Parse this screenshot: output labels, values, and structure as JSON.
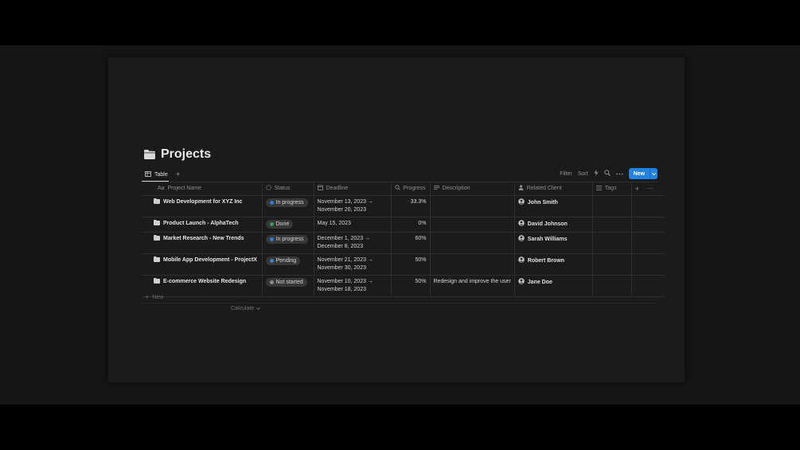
{
  "page": {
    "title": "Projects",
    "folder_icon": "folder-icon"
  },
  "views": {
    "active_tab": "Table",
    "add_view": "+"
  },
  "toolbar": {
    "filter": "Filter",
    "sort": "Sort",
    "new_label": "New"
  },
  "columns": {
    "name": "Project Name",
    "status": "Status",
    "deadline": "Deadline",
    "progress": "Progress",
    "description": "Description",
    "client": "Related Client",
    "tags": "Tags"
  },
  "rows": [
    {
      "name": "Web Development for XYZ Inc",
      "status": "In progress",
      "deadline_start": "November 13, 2023 →",
      "deadline_end": "November 20, 2023",
      "progress": "33.3%",
      "description": "",
      "client": "John Smith"
    },
    {
      "name": "Product Launch - AlphaTech",
      "status": "Done",
      "deadline_start": "May 15, 2023",
      "deadline_end": "",
      "progress": "0%",
      "description": "",
      "client": "David Johnson"
    },
    {
      "name": "Market Research - New Trends",
      "status": "In progress",
      "deadline_start": "December 1, 2023 →",
      "deadline_end": "December 8, 2023",
      "progress": "60%",
      "description": "",
      "client": "Sarah Williams"
    },
    {
      "name": "Mobile App Development - ProjectX",
      "status": "Pending",
      "deadline_start": "November 21, 2023 →",
      "deadline_end": "November 30, 2023",
      "progress": "50%",
      "description": "",
      "client": "Robert Brown"
    },
    {
      "name": "E-commerce Website Redesign",
      "status": "Not started",
      "deadline_start": "November 10, 2023 →",
      "deadline_end": "November 18, 2023",
      "progress": "50%",
      "description": "Redesign and improve the user",
      "client": "Jane Doe"
    }
  ],
  "footer": {
    "new_row": "New",
    "calculate": "Calculate"
  },
  "colors": {
    "accent": "#2383e2",
    "status_in_progress": "#2e7cd6",
    "status_done": "#3f9a5a",
    "status_pending": "#3b82c4",
    "status_not_started": "#8a8a8a"
  }
}
